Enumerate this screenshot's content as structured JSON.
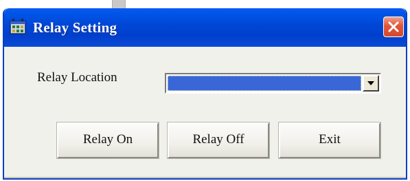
{
  "window": {
    "title": "Relay Setting",
    "icon": "grid-window-icon",
    "close_icon": "close-icon"
  },
  "form": {
    "relay_location_label": "Relay Location",
    "relay_location_value": "",
    "dropdown_icon": "chevron-down-icon"
  },
  "buttons": {
    "relay_on": "Relay On",
    "relay_off": "Relay Off",
    "exit": "Exit"
  },
  "colors": {
    "titlebar": "#0048d8",
    "close_button": "#e0553a",
    "selection": "#3a67d8",
    "client_background": "#f1f1ec"
  }
}
